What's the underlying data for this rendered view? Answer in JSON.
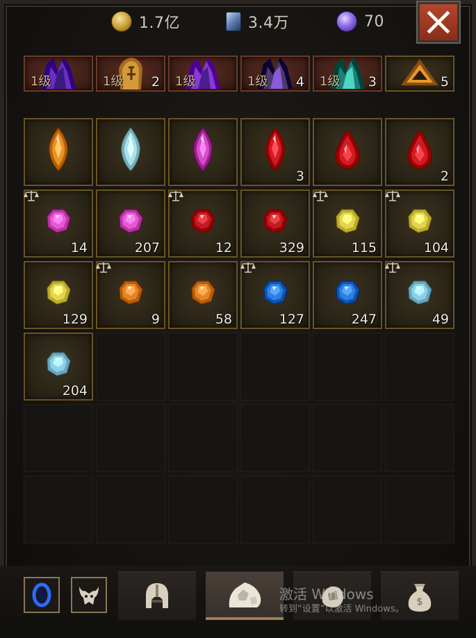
{
  "currencies": [
    {
      "icon": "gold-coin-icon",
      "value": "1.7亿"
    },
    {
      "icon": "crystal-shard-icon",
      "value": "3.4万"
    },
    {
      "icon": "purple-orb-icon",
      "value": "70"
    }
  ],
  "close_icon": "close-icon",
  "inventory": {
    "row0": [
      {
        "kind": "purple-crystal",
        "level": "1级",
        "qty": ""
      },
      {
        "kind": "amber-rune-stone",
        "level": "1级",
        "qty": "2"
      },
      {
        "kind": "purple-crystal-cluster",
        "level": "1级",
        "qty": ""
      },
      {
        "kind": "dark-crystal",
        "level": "1级",
        "qty": "4"
      },
      {
        "kind": "teal-crystal",
        "level": "1级",
        "qty": "3"
      },
      {
        "kind": "orange-triangle",
        "level": "",
        "qty": "5"
      }
    ],
    "row1": [
      {
        "kind": "amber-marquise",
        "qty": ""
      },
      {
        "kind": "diamond-marquise",
        "qty": ""
      },
      {
        "kind": "amethyst-marquise",
        "qty": ""
      },
      {
        "kind": "ruby-marquise",
        "qty": "3"
      },
      {
        "kind": "ruby-teardrop",
        "qty": ""
      },
      {
        "kind": "ruby-teardrop",
        "qty": "2"
      }
    ],
    "row2": [
      {
        "kind": "pink-gem",
        "qty": "14",
        "scale": true
      },
      {
        "kind": "pink-gem",
        "qty": "207",
        "scale": false
      },
      {
        "kind": "red-gem",
        "qty": "12",
        "scale": true
      },
      {
        "kind": "red-gem",
        "qty": "329",
        "scale": false
      },
      {
        "kind": "yellow-gem",
        "qty": "115",
        "scale": true
      },
      {
        "kind": "yellow-gem",
        "qty": "104",
        "scale": true
      }
    ],
    "row3": [
      {
        "kind": "yellow-gem",
        "qty": "129",
        "scale": false
      },
      {
        "kind": "orange-gem",
        "qty": "9",
        "scale": true
      },
      {
        "kind": "orange-gem",
        "qty": "58",
        "scale": false
      },
      {
        "kind": "blue-gem",
        "qty": "127",
        "scale": true
      },
      {
        "kind": "blue-gem",
        "qty": "247",
        "scale": false
      },
      {
        "kind": "aqua-gem",
        "qty": "49",
        "scale": true
      }
    ],
    "row4": [
      {
        "kind": "aqua-gem",
        "qty": "204",
        "scale": false
      }
    ]
  },
  "gem_colors": {
    "pink-gem": "#e45bd0",
    "red-gem": "#c21c22",
    "yellow-gem": "#e3d452",
    "orange-gem": "#e1862a",
    "blue-gem": "#2f7fe0",
    "aqua-gem": "#8fd0e6"
  },
  "bottom": {
    "left_buttons": [
      "blue-portal-icon",
      "demon-head-icon"
    ],
    "tabs": [
      "helmet-icon",
      "gem-pouch-icon",
      "crafting-material-icon",
      "gold-bag-icon"
    ],
    "active_tab": 1,
    "watermark_line1": "激活 Windows",
    "watermark_line2": "转到“设置”以激活 Windows。"
  }
}
